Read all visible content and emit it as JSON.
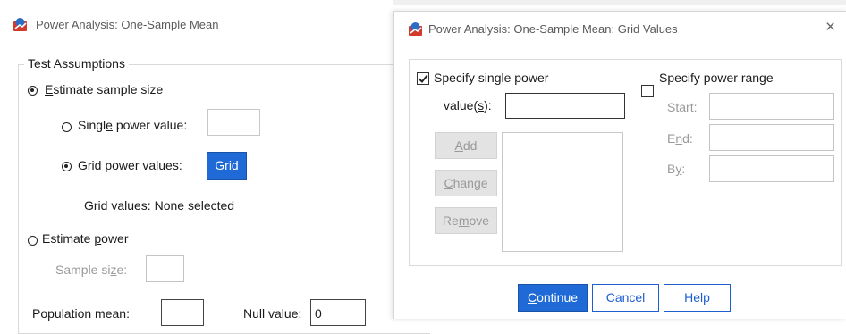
{
  "main_window": {
    "title": "Power Analysis: One-Sample Mean",
    "group_title": "Test Assumptions",
    "estimate_sample_size": {
      "pre": "",
      "key": "E",
      "post": "stimate sample size"
    },
    "single_power_value": {
      "pre": "Singl",
      "key": "e",
      "post": " power value:"
    },
    "grid_power_values": {
      "pre": "Grid ",
      "key": "p",
      "post": "ower values:"
    },
    "grid_button": {
      "pre": "",
      "key": "G",
      "post": "rid"
    },
    "grid_values_text": "Grid values: None selected",
    "estimate_power": {
      "pre": "Estimate ",
      "key": "p",
      "post": "ower"
    },
    "sample_size": {
      "pre": "Sample si",
      "key": "z",
      "post": "e:"
    },
    "population_mean_label": "Population mean:",
    "null_value_label": "Null value:",
    "null_value": "0"
  },
  "dialog": {
    "title": "Power Analysis: One-Sample Mean: Grid Values",
    "close_glyph": "×",
    "specify_single_power": "Specify single power",
    "values_label": {
      "pre": "value(",
      "key": "s",
      "post": "):"
    },
    "add_button": {
      "pre": "",
      "key": "A",
      "post": "dd"
    },
    "change_button": {
      "pre": "",
      "key": "C",
      "post": "hange"
    },
    "remove_button": {
      "pre": "Re",
      "key": "m",
      "post": "ove"
    },
    "specify_power_range": "Specify power range",
    "start_label": {
      "pre": "Sta",
      "key": "r",
      "post": "t:"
    },
    "end_label": {
      "pre": "E",
      "key": "n",
      "post": "d:"
    },
    "by_label": {
      "pre": "B",
      "key": "y",
      "post": ":"
    },
    "continue_button": {
      "pre": "",
      "key": "C",
      "post": "ontinue"
    },
    "cancel_button": "Cancel",
    "help_button": "Help"
  },
  "colors": {
    "accent": "#1f6ad6",
    "disabled_text": "#9a9a9a"
  },
  "icons": {
    "app": "spss-app-icon",
    "close": "close-icon",
    "radio": "radio-button",
    "checkbox": "checkbox"
  }
}
